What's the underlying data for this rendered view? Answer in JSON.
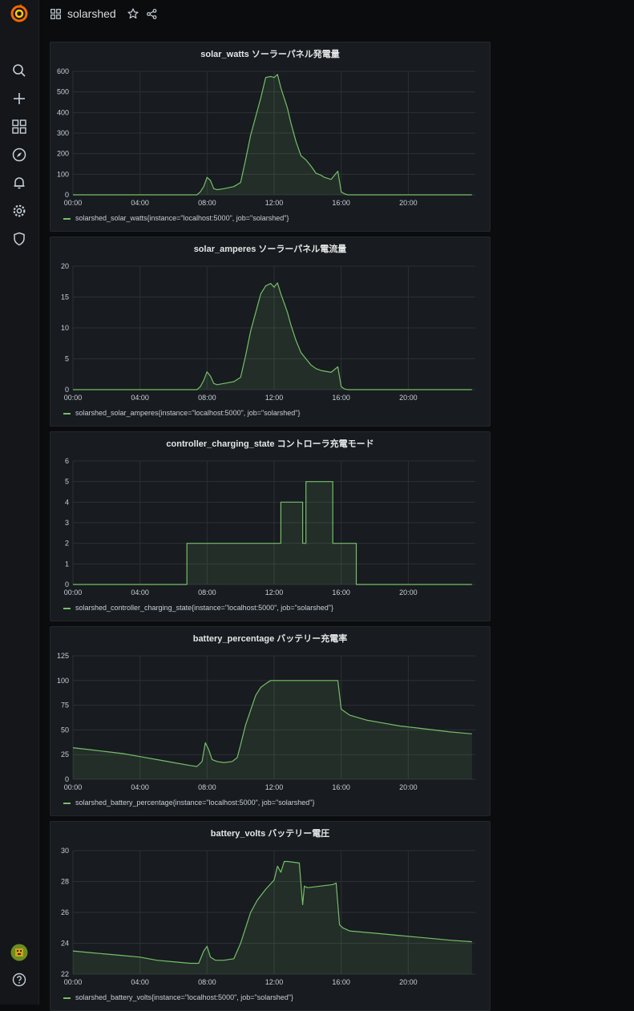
{
  "dashboard": {
    "title": "solarshed"
  },
  "sidebar": {
    "items": [
      {
        "name": "search-icon"
      },
      {
        "name": "plus-icon"
      },
      {
        "name": "dashboards-icon"
      },
      {
        "name": "explore-icon"
      },
      {
        "name": "bell-icon"
      },
      {
        "name": "gear-icon"
      },
      {
        "name": "shield-icon"
      }
    ]
  },
  "colors": {
    "series": "#73bf69",
    "fill": "#1f2a1e",
    "grid": "#2c3035",
    "bg": "#181b1f"
  },
  "chart_data": [
    {
      "type": "area",
      "title": "solar_watts ソーラーパネル発電量",
      "legend": "solarshed_solar_watts{instance=\"localhost:5000\", job=\"solarshed\"}",
      "xlabels": [
        "00:00",
        "04:00",
        "08:00",
        "12:00",
        "16:00",
        "20:00"
      ],
      "ylabels": [
        "0",
        "100",
        "200",
        "300",
        "400",
        "500",
        "600"
      ],
      "ylim": [
        0,
        600
      ],
      "x": [
        0,
        7.4,
        7.6,
        7.8,
        8.0,
        8.2,
        8.4,
        8.6,
        9.0,
        9.6,
        10.0,
        10.3,
        10.6,
        10.9,
        11.2,
        11.5,
        11.8,
        12.0,
        12.2,
        12.4,
        12.6,
        12.8,
        13.0,
        13.3,
        13.6,
        13.9,
        14.2,
        14.5,
        14.8,
        15.0,
        15.4,
        15.8,
        16.0,
        16.2,
        16.4,
        16.6,
        23.8
      ],
      "y": [
        0,
        0,
        15,
        40,
        85,
        70,
        30,
        25,
        30,
        40,
        60,
        170,
        290,
        380,
        470,
        570,
        575,
        570,
        585,
        520,
        470,
        420,
        350,
        260,
        190,
        170,
        140,
        105,
        95,
        85,
        75,
        115,
        15,
        5,
        0,
        0,
        0
      ]
    },
    {
      "type": "area",
      "title": "solar_amperes ソーラーパネル電流量",
      "legend": "solarshed_solar_amperes{instance=\"localhost:5000\", job=\"solarshed\"}",
      "xlabels": [
        "00:00",
        "04:00",
        "08:00",
        "12:00",
        "16:00",
        "20:00"
      ],
      "ylabels": [
        "0",
        "5",
        "10",
        "15",
        "20"
      ],
      "ylim": [
        0,
        20
      ],
      "x": [
        0,
        7.4,
        7.6,
        7.8,
        8.0,
        8.2,
        8.4,
        8.6,
        9.0,
        9.6,
        10.0,
        10.3,
        10.6,
        10.9,
        11.2,
        11.5,
        11.8,
        12.0,
        12.2,
        12.4,
        12.6,
        12.8,
        13.0,
        13.3,
        13.6,
        13.9,
        14.2,
        14.5,
        14.8,
        15.0,
        15.4,
        15.8,
        16.0,
        16.2,
        16.4,
        16.6,
        23.8
      ],
      "y": [
        0,
        0,
        0.5,
        1.5,
        2.9,
        2.2,
        1.0,
        0.8,
        1.0,
        1.3,
        2.0,
        5.5,
        9.5,
        12.5,
        15.5,
        16.8,
        17.2,
        16.6,
        17.3,
        15.5,
        14.0,
        12.5,
        10.5,
        8.0,
        6.0,
        5.0,
        4.0,
        3.4,
        3.1,
        3.0,
        2.8,
        3.7,
        0.5,
        0.1,
        0,
        0,
        0
      ]
    },
    {
      "type": "area",
      "title": "controller_charging_state コントローラ充電モード",
      "legend": "solarshed_controller_charging_state{instance=\"localhost:5000\", job=\"solarshed\"}",
      "xlabels": [
        "00:00",
        "04:00",
        "08:00",
        "12:00",
        "16:00",
        "20:00"
      ],
      "ylabels": [
        "0",
        "1",
        "2",
        "3",
        "4",
        "5",
        "6"
      ],
      "ylim": [
        0,
        6
      ],
      "x": [
        0,
        6.8,
        6.8,
        12.4,
        12.4,
        13.7,
        13.7,
        13.9,
        13.9,
        15.5,
        15.5,
        16.9,
        16.9,
        23.8
      ],
      "y": [
        0,
        0,
        2,
        2,
        4,
        4,
        2,
        2,
        5,
        5,
        2,
        2,
        0,
        0
      ]
    },
    {
      "type": "area",
      "title": "battery_percentage バッテリー充電率",
      "legend": "solarshed_battery_percentage{instance=\"localhost:5000\", job=\"solarshed\"}",
      "xlabels": [
        "00:00",
        "04:00",
        "08:00",
        "12:00",
        "16:00",
        "20:00"
      ],
      "ylabels": [
        "0",
        "25",
        "50",
        "75",
        "100",
        "125"
      ],
      "ylim": [
        0,
        125
      ],
      "x": [
        0,
        1,
        2,
        3,
        4,
        5,
        6,
        7,
        7.4,
        7.7,
        7.9,
        8.1,
        8.3,
        8.6,
        9.0,
        9.5,
        9.8,
        10.0,
        10.3,
        10.6,
        10.9,
        11.2,
        11.6,
        11.8,
        12.5,
        13.5,
        14.5,
        15.5,
        15.8,
        16.0,
        16.5,
        17.5,
        18.5,
        19.5,
        20.5,
        21.5,
        22.5,
        23.8
      ],
      "y": [
        32,
        30,
        28,
        26,
        23,
        20,
        17,
        14,
        13,
        18,
        37,
        30,
        20,
        18,
        17,
        18,
        22,
        35,
        55,
        70,
        85,
        93,
        98,
        100,
        100,
        100,
        100,
        100,
        100,
        71,
        65,
        60,
        57,
        54,
        52,
        50,
        48,
        46
      ]
    },
    {
      "type": "area",
      "title": "battery_volts バッテリー電圧",
      "legend": "solarshed_battery_volts{instance=\"localhost:5000\", job=\"solarshed\"}",
      "xlabels": [
        "00:00",
        "04:00",
        "08:00",
        "12:00",
        "16:00",
        "20:00"
      ],
      "ylabels": [
        "22",
        "24",
        "26",
        "28",
        "30"
      ],
      "ylim": [
        22,
        30
      ],
      "x": [
        0,
        1,
        2,
        3,
        4,
        5,
        6,
        7,
        7.5,
        7.8,
        8.0,
        8.2,
        8.5,
        9.0,
        9.6,
        10.0,
        10.3,
        10.6,
        11.0,
        11.5,
        12.0,
        12.2,
        12.4,
        12.6,
        12.8,
        13.5,
        13.7,
        13.8,
        14.0,
        15.5,
        15.7,
        15.9,
        16.1,
        16.5,
        17.5,
        18.5,
        19.5,
        20.5,
        21.5,
        22.5,
        23.8
      ],
      "y": [
        23.5,
        23.4,
        23.3,
        23.2,
        23.1,
        22.9,
        22.8,
        22.7,
        22.7,
        23.5,
        23.8,
        23.1,
        22.9,
        22.9,
        23.0,
        24.0,
        25.0,
        26.0,
        26.8,
        27.5,
        28.1,
        29.0,
        28.6,
        29.3,
        29.3,
        29.2,
        26.5,
        27.7,
        27.6,
        27.8,
        27.9,
        25.2,
        25.0,
        24.8,
        24.7,
        24.6,
        24.5,
        24.4,
        24.3,
        24.2,
        24.1
      ]
    }
  ]
}
